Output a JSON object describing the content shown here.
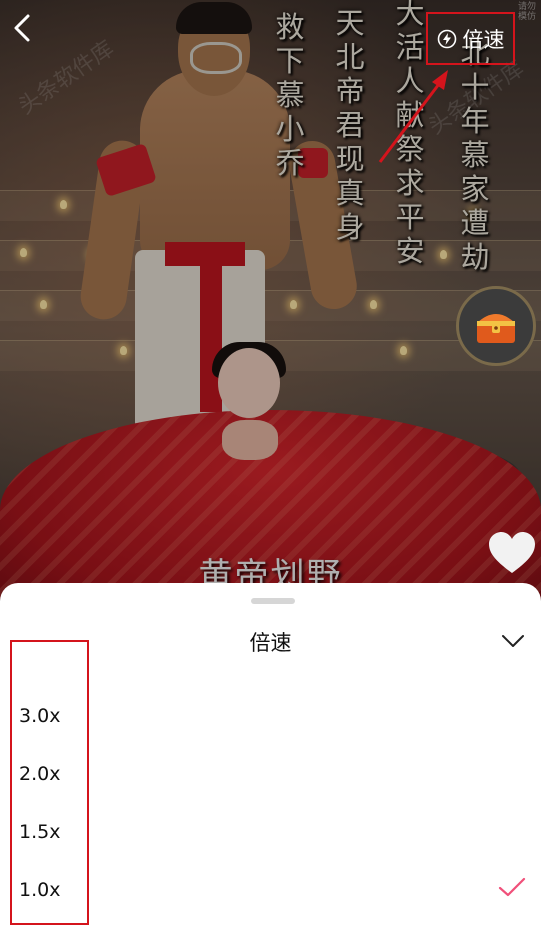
{
  "video": {
    "subtitle": "黄帝划野",
    "watermark": "头条软件库",
    "vertical_text": [
      "救下慕小乔",
      "天北帝君现真身",
      "大活人献祭求平安",
      "北十年慕家遭劫"
    ],
    "speed_button_label": "倍速",
    "speed_button_icon": "speed-lightning-icon",
    "corner_tag": "请勿模仿"
  },
  "sheet": {
    "title": "倍速",
    "options": [
      {
        "label": "3.0x",
        "selected": false
      },
      {
        "label": "2.0x",
        "selected": false
      },
      {
        "label": "1.5x",
        "selected": false
      },
      {
        "label": "1.0x",
        "selected": true
      }
    ]
  },
  "colors": {
    "annotation_red": "#d4141c",
    "check_pink": "#f0507a",
    "sheet_bg": "#ffffff"
  }
}
